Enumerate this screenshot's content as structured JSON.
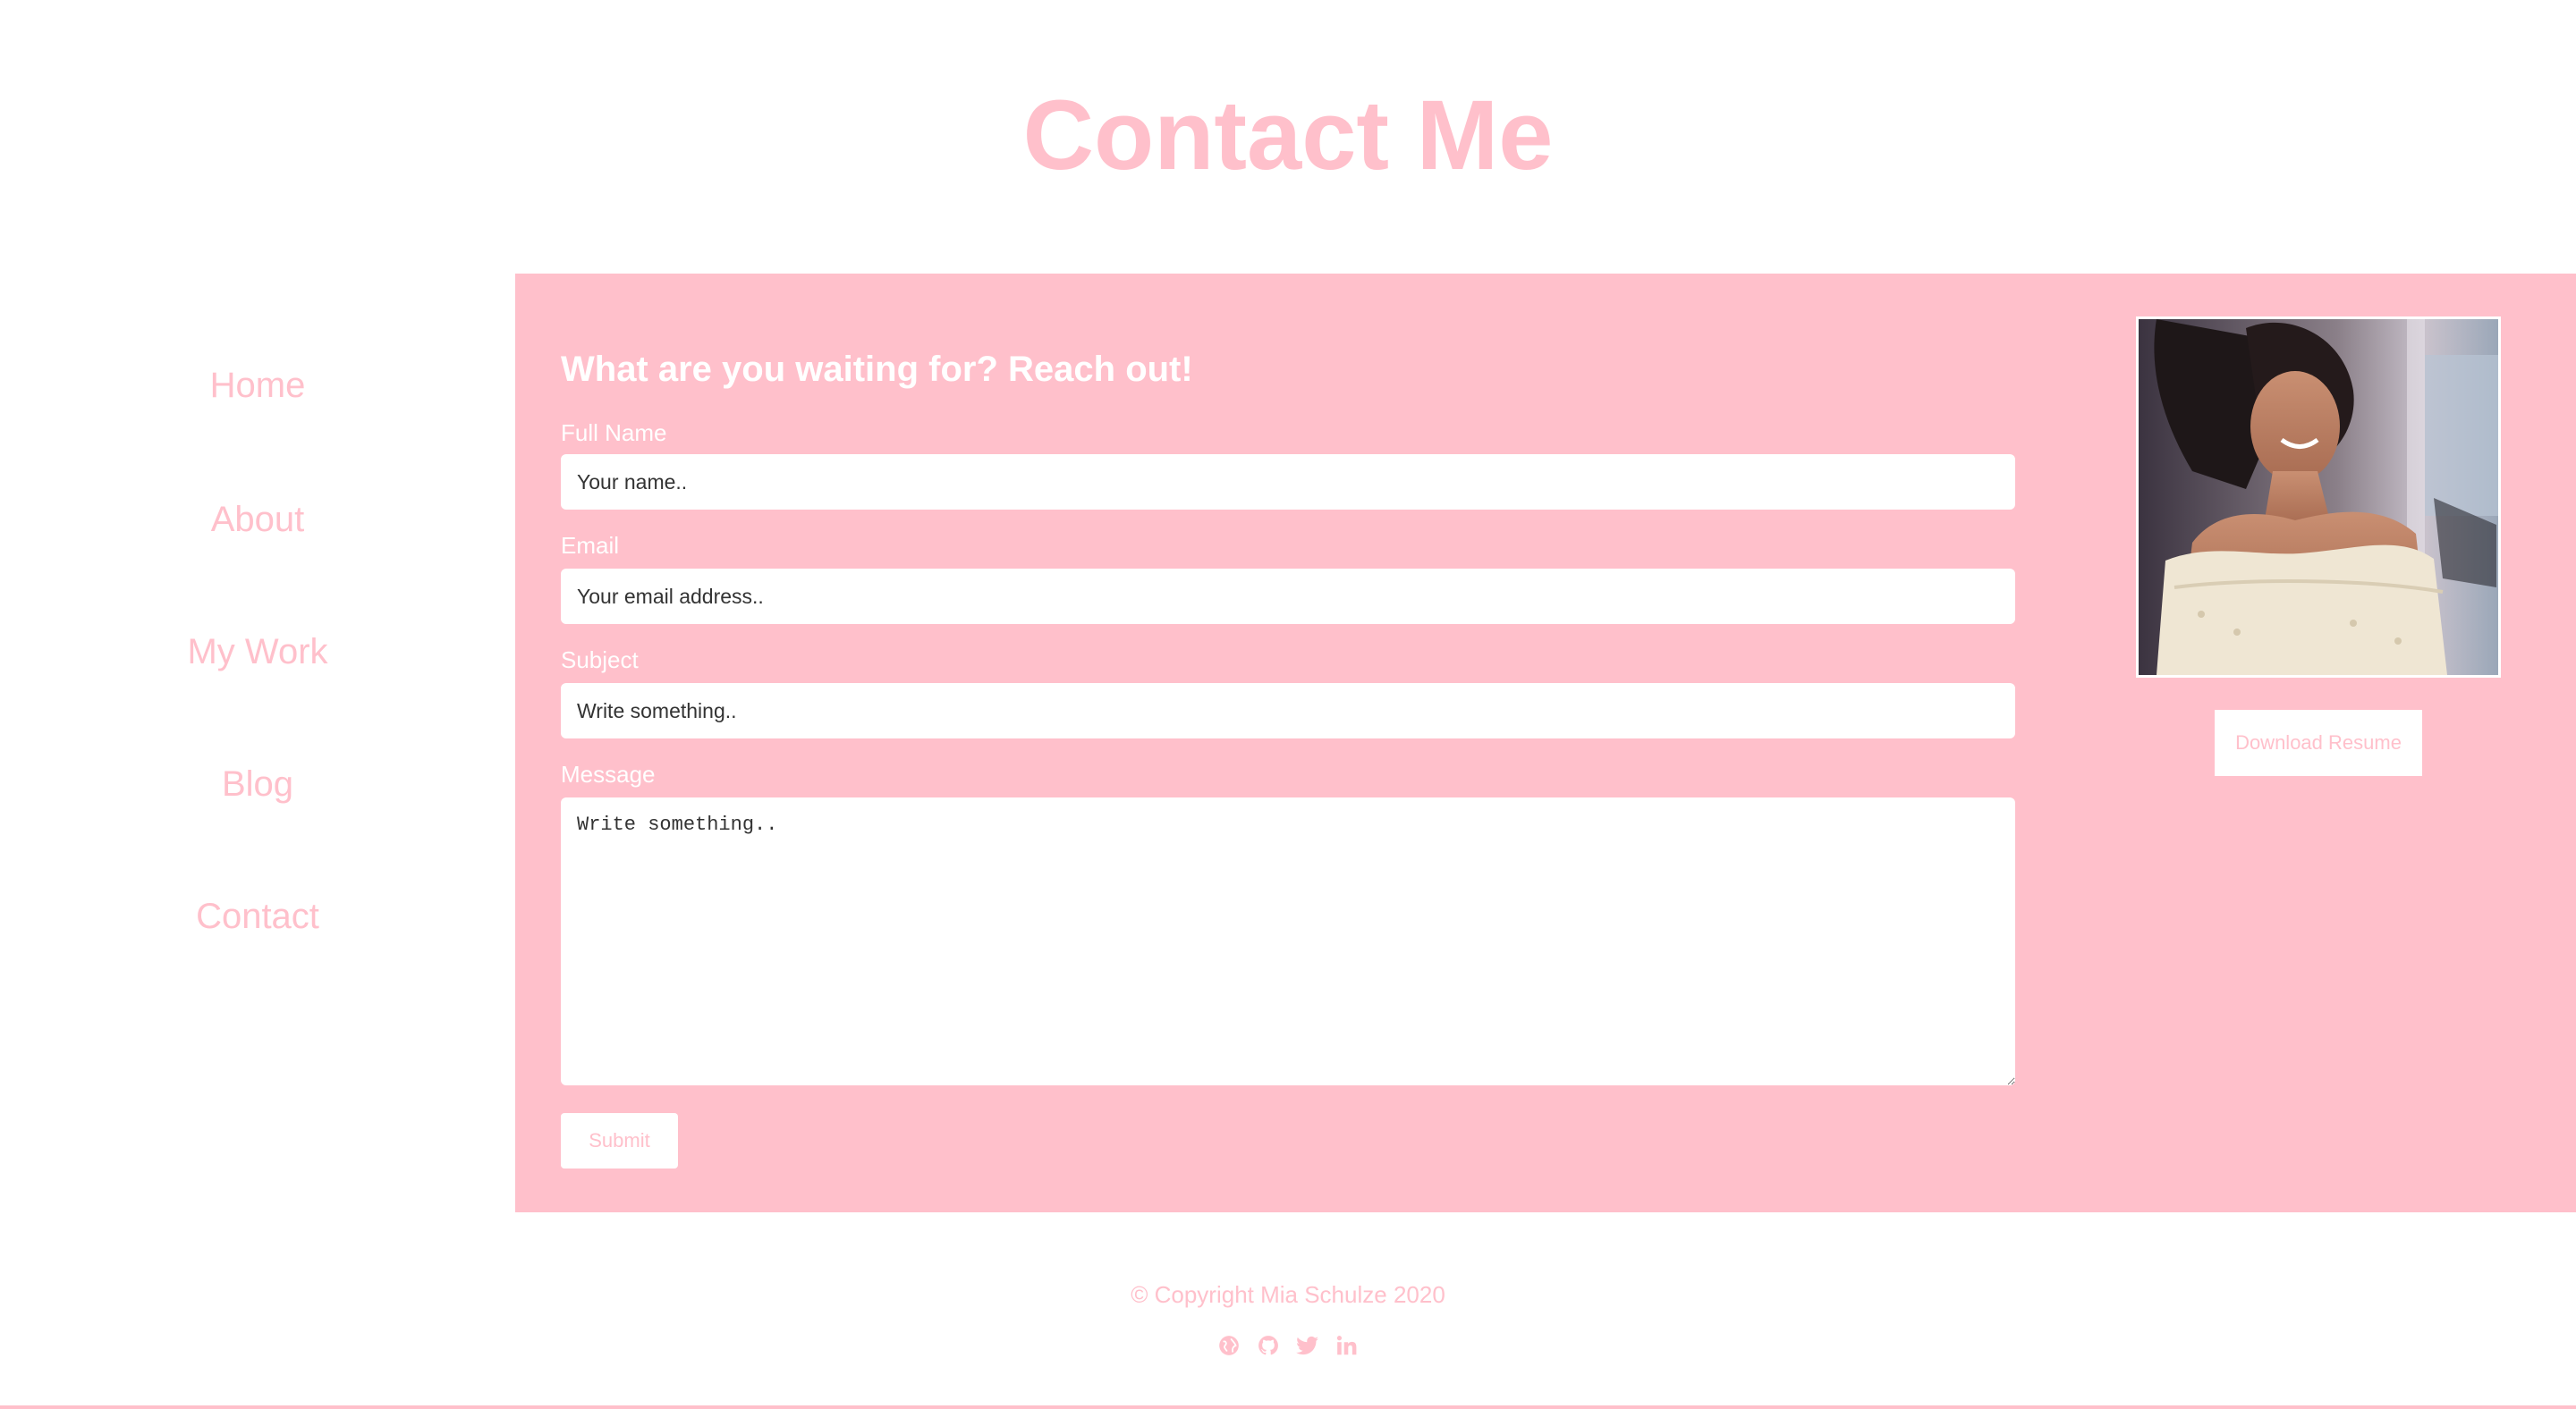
{
  "header": {
    "title": "Contact Me"
  },
  "sidebar": {
    "items": [
      {
        "label": "Home"
      },
      {
        "label": "About"
      },
      {
        "label": "My Work"
      },
      {
        "label": "Blog"
      },
      {
        "label": "Contact"
      }
    ]
  },
  "form": {
    "heading": "What are you waiting for? Reach out!",
    "full_name": {
      "label": "Full Name",
      "placeholder": "Your name..",
      "value": ""
    },
    "email": {
      "label": "Email",
      "placeholder": "Your email address..",
      "value": ""
    },
    "subject": {
      "label": "Subject",
      "placeholder": "Write something..",
      "value": ""
    },
    "message": {
      "label": "Message",
      "placeholder": "Write something..",
      "value": ""
    },
    "submit_label": "Submit"
  },
  "profile": {
    "resume_button_label": "Download Resume"
  },
  "footer": {
    "copyright": "© Copyright Mia Schulze 2020",
    "social_icons": [
      "globe-icon",
      "github-icon",
      "twitter-icon",
      "linkedin-icon"
    ]
  },
  "colors": {
    "accent": "#ffc0cb",
    "panel_background": "#ffc0cb",
    "text_on_accent": "#ffffff",
    "page_background": "#ffffff"
  }
}
